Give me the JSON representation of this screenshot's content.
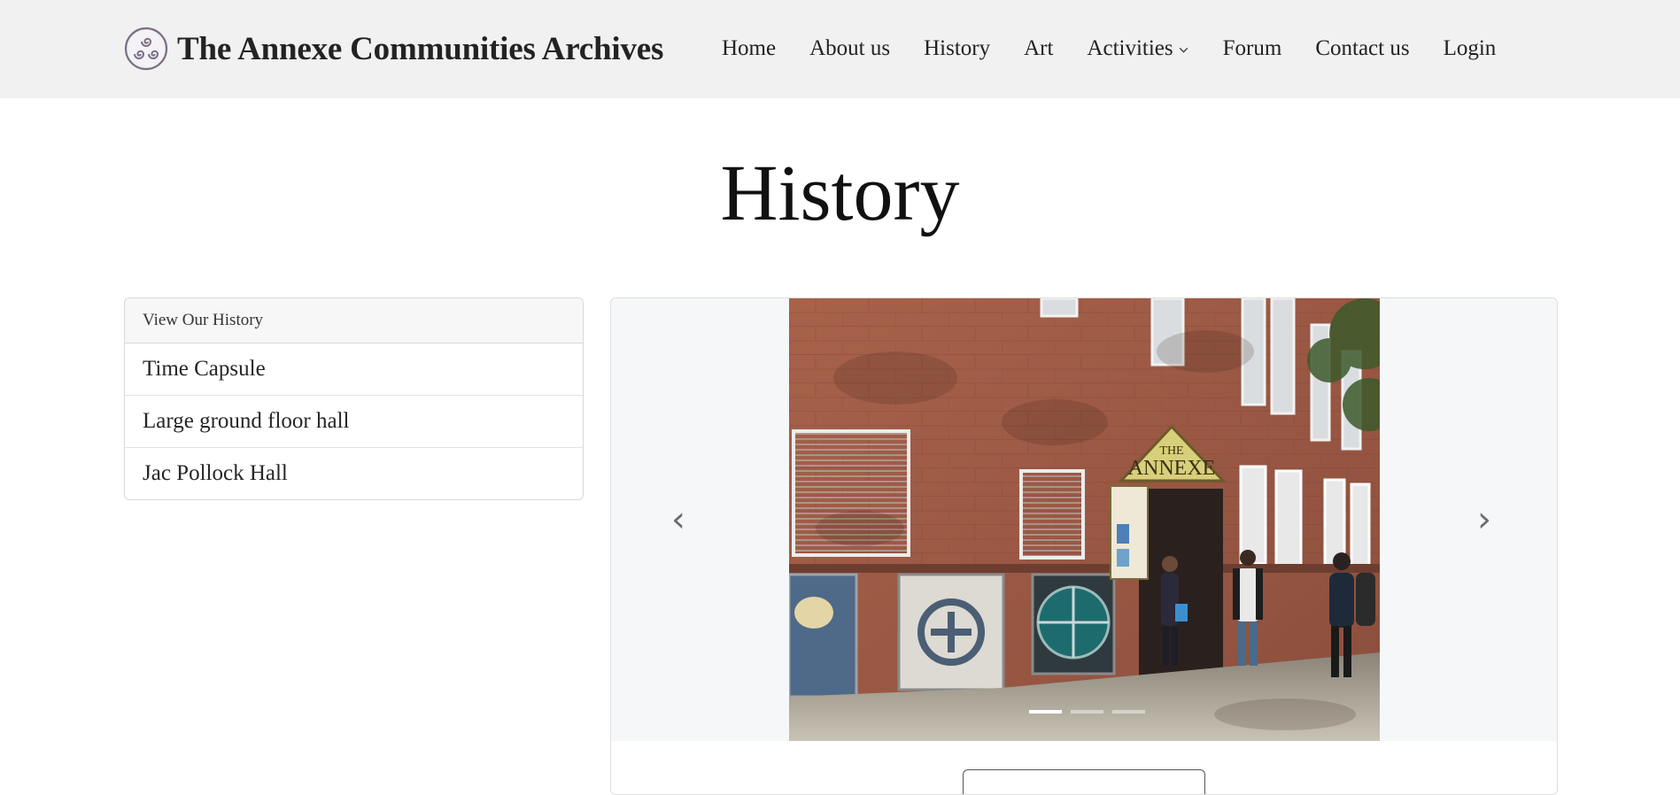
{
  "header": {
    "site_title": "The Annexe Communities Archives",
    "logo_icon": "triple-spiral-logo-icon",
    "nav": [
      {
        "label": "Home"
      },
      {
        "label": "About us"
      },
      {
        "label": "History"
      },
      {
        "label": "Art"
      },
      {
        "label": "Activities",
        "dropdown": true
      },
      {
        "label": "Forum"
      },
      {
        "label": "Contact us"
      },
      {
        "label": "Login"
      }
    ]
  },
  "page": {
    "title": "History"
  },
  "sidebar": {
    "header": "View Our History",
    "items": [
      {
        "label": "Time Capsule"
      },
      {
        "label": "Large ground floor hall"
      },
      {
        "label": "Jac Pollock Hall"
      }
    ]
  },
  "carousel": {
    "prev_icon": "chevron-left-icon",
    "next_icon": "chevron-right-icon",
    "prev_glyph": "‹",
    "next_glyph": "›",
    "slide_count": 3,
    "active_slide": 1,
    "slide_sign": {
      "line1": "THE",
      "line2": "ANNEXE"
    }
  },
  "colors": {
    "navbar_bg": "#f1f1f1",
    "carousel_bg": "#f6f7f9",
    "logo_purple": "#7a6e85"
  }
}
